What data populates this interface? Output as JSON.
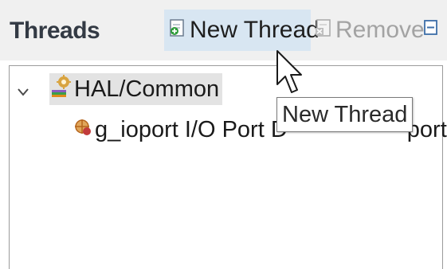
{
  "panel": {
    "title": "Threads",
    "new_thread_label": "New Thread",
    "remove_label": "Remove"
  },
  "tree": {
    "root": {
      "label": "HAL/Common",
      "expanded": true,
      "icon": "hal-gear-icon"
    },
    "children": [
      {
        "text_start": "g_ioport I/O Port D",
        "text_end": "port",
        "icon": "ioport-icon"
      }
    ]
  },
  "tooltip": {
    "text": "New Thread"
  },
  "icons": {
    "new_thread": "new-thread-icon",
    "remove": "remove-icon",
    "collapse": "collapse-all-icon",
    "expand_chevron": "chevron-down-icon",
    "cursor": "mouse-pointer-icon"
  },
  "colors": {
    "header_bg": "#f0f0f0",
    "hover_highlight": "#d8e6f2",
    "selected_node_bg": "#e3e3e3",
    "disabled_text": "#a3a3a3"
  }
}
